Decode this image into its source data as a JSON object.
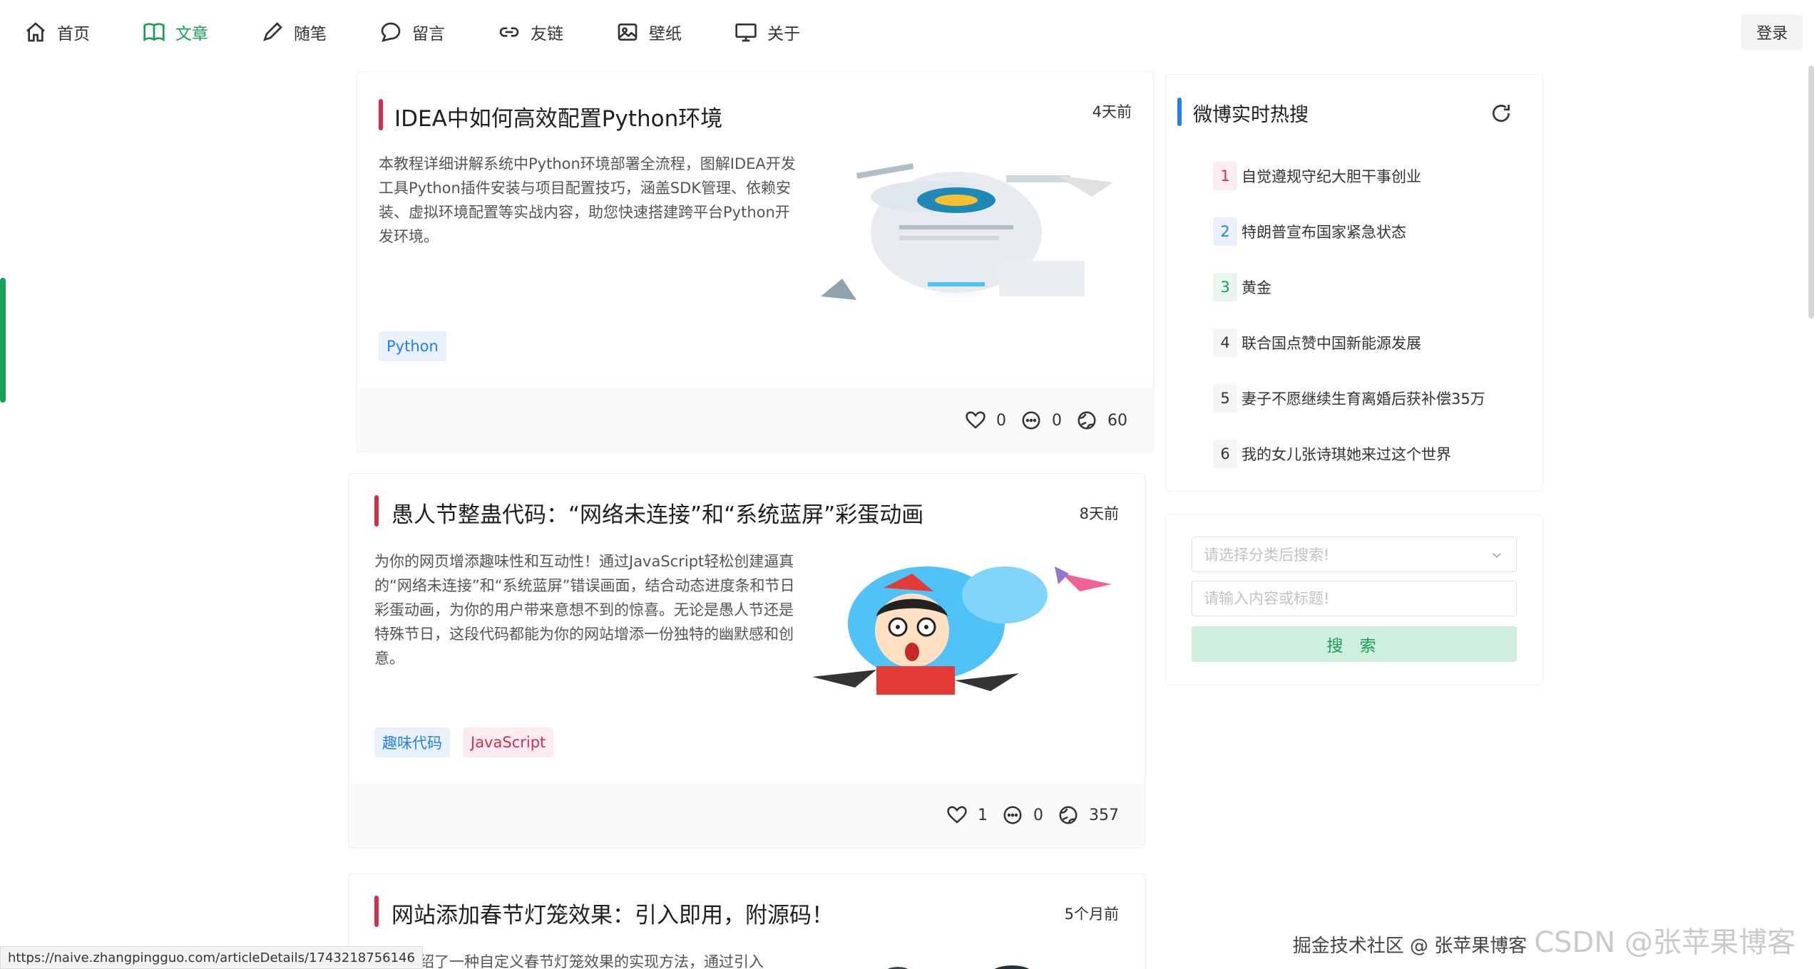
{
  "nav": {
    "items": [
      {
        "label": "首页",
        "icon": "home-icon"
      },
      {
        "label": "文章",
        "icon": "book-icon"
      },
      {
        "label": "随笔",
        "icon": "pen-icon"
      },
      {
        "label": "留言",
        "icon": "chat-bubble-icon"
      },
      {
        "label": "友链",
        "icon": "link-icon"
      },
      {
        "label": "壁纸",
        "icon": "image-icon"
      },
      {
        "label": "关于",
        "icon": "monitor-icon"
      }
    ],
    "active_index": 1,
    "login_label": "登录"
  },
  "articles": [
    {
      "title": "IDEA中如何高效配置Python环境",
      "time": "4天前",
      "description": "本教程详细讲解系统中Python环境部署全流程，图解IDEA开发工具Python插件安装与项目配置技巧，涵盖SDK管理、依赖安装、虚拟环境配置等实战内容，助您快速搭建跨平台Python开发环境。",
      "tags": [
        {
          "label": "Python",
          "color": "blue"
        }
      ],
      "likes": "0",
      "comments": "0",
      "views": "60"
    },
    {
      "title": "愚人节整蛊代码：“网络未连接”和“系统蓝屏”彩蛋动画",
      "time": "8天前",
      "description": "为你的网页增添趣味性和互动性！通过JavaScript轻松创建逼真的“网络未连接”和“系统蓝屏”错误画面，结合动态进度条和节日彩蛋动画，为你的用户带来意想不到的惊喜。无论是愚人节还是特殊节日，这段代码都能为你的网站增添一份独特的幽默感和创意。",
      "tags": [
        {
          "label": "趣味代码",
          "color": "blue"
        },
        {
          "label": "JavaScript",
          "color": "red"
        }
      ],
      "likes": "1",
      "comments": "0",
      "views": "357"
    },
    {
      "title": "网站添加春节灯笼效果：引入即用，附源码！",
      "time": "5个月前",
      "description": "本文介绍了一种自定义春节灯笼效果的实现方法，通过引入"
    }
  ],
  "hot_search": {
    "title": "微博实时热搜",
    "items": [
      {
        "rank": "1",
        "text": "自觉遵规守纪大胆干事创业"
      },
      {
        "rank": "2",
        "text": "特朗普宣布国家紧急状态"
      },
      {
        "rank": "3",
        "text": "黄金"
      },
      {
        "rank": "4",
        "text": "联合国点赞中国新能源发展"
      },
      {
        "rank": "5",
        "text": "妻子不愿继续生育离婚后获补偿35万"
      },
      {
        "rank": "6",
        "text": "我的女儿张诗琪她来过这个世界"
      }
    ]
  },
  "search": {
    "category_placeholder": "请选择分类后搜索!",
    "keyword_placeholder": "请输入内容或标题!",
    "button_label": "搜 索"
  },
  "status_url": "https://naive.zhangpingguo.com/articleDetails/1743218756146",
  "watermark": {
    "small": "掘金技术社区 @ 张苹果博客",
    "large": "CSDN @张苹果博客"
  },
  "colors": {
    "accent_green": "#18a058",
    "accent_red": "#d03050",
    "accent_blue": "#2080f0"
  }
}
